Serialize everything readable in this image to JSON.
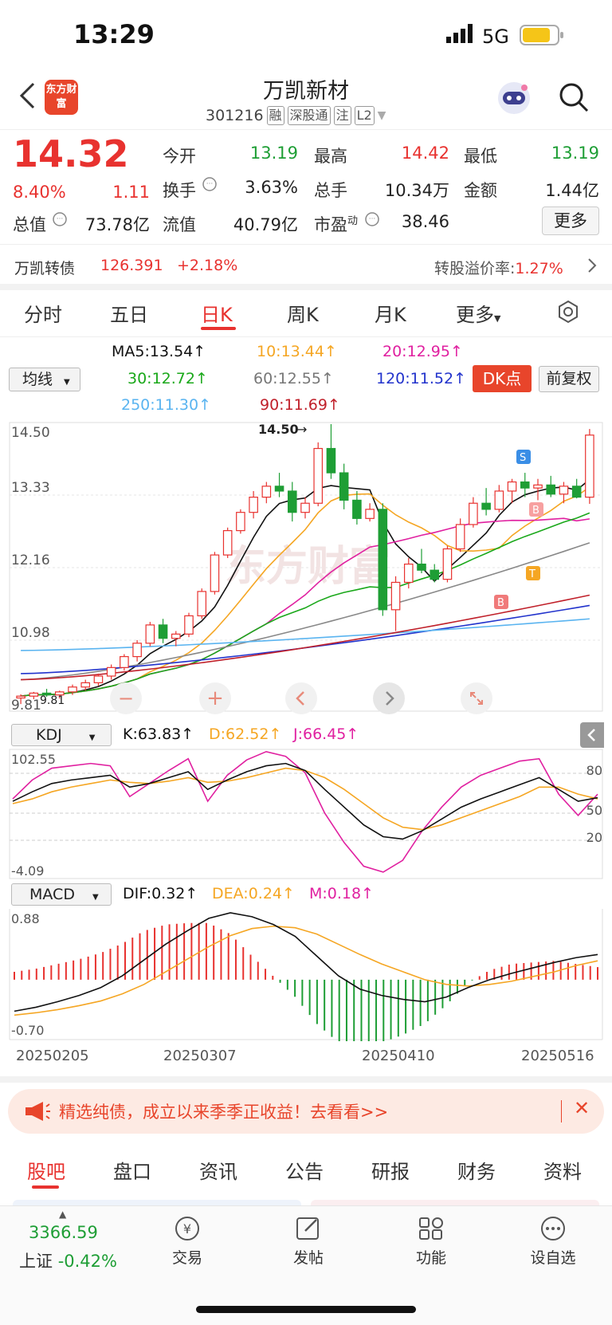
{
  "status": {
    "time": "13:29",
    "network": "5G"
  },
  "header": {
    "logo_text": "东方财富",
    "title": "万凯新材",
    "code": "301216",
    "tags": [
      "融",
      "深股通",
      "注",
      "L2"
    ]
  },
  "quote": {
    "price": "14.32",
    "change_pct": "8.40%",
    "change": "1.11",
    "open_label": "今开",
    "open": "13.19",
    "high_label": "最高",
    "high": "14.42",
    "low_label": "最低",
    "low": "13.19",
    "turnover_label": "换手",
    "turnover": "3.63%",
    "volume_label": "总手",
    "volume": "10.34万",
    "amount_label": "金额",
    "amount": "1.44亿",
    "mktcap_label": "总值",
    "mktcap": "73.78亿",
    "float_label": "流值",
    "float": "40.79亿",
    "pe_label": "市盈",
    "pe_sup": "动",
    "pe": "38.46",
    "more_label": "更多"
  },
  "bond": {
    "name": "万凯转债",
    "price": "126.391",
    "change": "+2.18%",
    "premium_label": "转股溢价率:",
    "premium": "1.27%"
  },
  "period_tabs": [
    "分时",
    "五日",
    "日K",
    "周K",
    "月K",
    "更多"
  ],
  "active_period": "日K",
  "ma": {
    "selector": "均线",
    "ma5": "MA5:13.54",
    "ma10": "10:13.44",
    "ma20": "20:12.95",
    "ma30": "30:12.72",
    "ma60": "60:12.55",
    "ma120": "120:11.52",
    "ma250": "250:11.30",
    "ma90": "90:11.69",
    "dk_label": "DK点",
    "adjust_label": "前复权"
  },
  "colors": {
    "red": "#e8322f",
    "green": "#1e9e35",
    "ma5": "#111111",
    "ma10": "#f5a623",
    "ma20": "#e020a0",
    "ma30": "#1aa81a",
    "ma60": "#888888",
    "ma120": "#2233cc",
    "ma250": "#5ab4f0",
    "ma90": "#c0202a"
  },
  "price_axis": {
    "top": "14.50",
    "l2": "13.33",
    "l3": "12.16",
    "l4": "10.98",
    "bottom": "9.81"
  },
  "annotations": {
    "high_mark": "14.50",
    "low_mark": "9.81"
  },
  "kdj": {
    "selector": "KDJ",
    "k": "K:63.83",
    "d": "D:62.52",
    "j": "J:66.45",
    "top": "102.55",
    "bottom": "-4.09",
    "lvl80": "80",
    "lvl50": "50",
    "lvl20": "20"
  },
  "macd": {
    "selector": "MACD",
    "dif": "DIF:0.32",
    "dea": "DEA:0.24",
    "m": "M:0.18",
    "top": "0.88",
    "bottom": "-0.70"
  },
  "dates": [
    "20250205",
    "20250307",
    "20250410",
    "20250516"
  ],
  "banner": {
    "text": "精选纯债，成立以来季季正收益！去看看>>"
  },
  "content_tabs": [
    "股吧",
    "盘口",
    "资讯",
    "公告",
    "研报",
    "财务",
    "资料"
  ],
  "bottom_nav": {
    "index_value": "3366.59",
    "index_name": "上证",
    "index_change": "-0.42%",
    "items": [
      "交易",
      "发帖",
      "功能",
      "设自选"
    ]
  },
  "chart_data": {
    "type": "candlestick",
    "ohlc_approx": [
      [
        10.0,
        10.06,
        9.9,
        10.03
      ],
      [
        10.03,
        10.1,
        9.98,
        10.08
      ],
      [
        10.08,
        10.15,
        10.02,
        10.05
      ],
      [
        10.05,
        10.12,
        9.99,
        10.1
      ],
      [
        10.1,
        10.22,
        10.05,
        10.18
      ],
      [
        10.18,
        10.3,
        10.12,
        10.25
      ],
      [
        10.25,
        10.4,
        10.2,
        10.36
      ],
      [
        10.36,
        10.55,
        10.3,
        10.5
      ],
      [
        10.5,
        10.72,
        10.45,
        10.68
      ],
      [
        10.68,
        10.95,
        10.6,
        10.9
      ],
      [
        10.9,
        11.25,
        10.85,
        11.2
      ],
      [
        11.2,
        11.3,
        10.9,
        10.98
      ],
      [
        10.98,
        11.1,
        10.85,
        11.05
      ],
      [
        11.05,
        11.4,
        11.0,
        11.35
      ],
      [
        11.35,
        11.8,
        11.3,
        11.75
      ],
      [
        11.75,
        12.4,
        11.7,
        12.35
      ],
      [
        12.35,
        12.8,
        12.3,
        12.75
      ],
      [
        12.75,
        13.1,
        12.7,
        13.05
      ],
      [
        13.05,
        13.4,
        12.95,
        13.3
      ],
      [
        13.3,
        13.55,
        13.2,
        13.48
      ],
      [
        13.48,
        13.7,
        13.3,
        13.4
      ],
      [
        13.4,
        13.55,
        12.9,
        13.05
      ],
      [
        13.05,
        13.3,
        12.95,
        13.2
      ],
      [
        13.2,
        14.2,
        13.15,
        14.1
      ],
      [
        14.1,
        14.5,
        13.6,
        13.7
      ],
      [
        13.7,
        13.85,
        13.1,
        13.25
      ],
      [
        13.25,
        13.4,
        12.85,
        12.95
      ],
      [
        12.95,
        13.2,
        12.9,
        13.1
      ],
      [
        13.1,
        13.2,
        11.35,
        11.45
      ],
      [
        11.45,
        12.0,
        11.1,
        11.9
      ],
      [
        11.9,
        12.3,
        11.8,
        12.2
      ],
      [
        12.2,
        12.45,
        12.05,
        12.1
      ],
      [
        12.1,
        12.2,
        11.9,
        11.95
      ],
      [
        11.95,
        12.5,
        11.9,
        12.45
      ],
      [
        12.45,
        12.95,
        12.4,
        12.85
      ],
      [
        12.85,
        13.3,
        12.8,
        13.2
      ],
      [
        13.2,
        13.45,
        13.0,
        13.1
      ],
      [
        13.1,
        13.5,
        13.05,
        13.4
      ],
      [
        13.4,
        13.6,
        13.2,
        13.55
      ],
      [
        13.55,
        13.7,
        13.3,
        13.45
      ],
      [
        13.45,
        13.6,
        13.25,
        13.5
      ],
      [
        13.5,
        13.65,
        13.3,
        13.35
      ],
      [
        13.35,
        13.55,
        13.2,
        13.48
      ],
      [
        13.48,
        13.6,
        13.28,
        13.3
      ],
      [
        13.3,
        14.42,
        13.19,
        14.32
      ]
    ],
    "kdj_k": [
      60,
      68,
      75,
      78,
      80,
      82,
      72,
      75,
      80,
      85,
      70,
      78,
      85,
      90,
      92,
      86,
      70,
      55,
      40,
      30,
      28,
      35,
      45,
      55,
      62,
      68,
      74,
      80,
      70,
      60,
      63
    ],
    "kdj_d": [
      58,
      62,
      68,
      72,
      75,
      78,
      76,
      75,
      77,
      80,
      76,
      77,
      80,
      84,
      88,
      86,
      80,
      70,
      58,
      46,
      38,
      36,
      40,
      46,
      52,
      58,
      64,
      72,
      72,
      66,
      62
    ],
    "kdj_j": [
      62,
      78,
      88,
      90,
      92,
      90,
      64,
      75,
      86,
      96,
      60,
      82,
      95,
      102,
      98,
      84,
      50,
      25,
      5,
      0,
      10,
      35,
      55,
      72,
      82,
      88,
      94,
      96,
      66,
      48,
      66
    ],
    "macd_dif": [
      -0.4,
      -0.35,
      -0.28,
      -0.2,
      -0.1,
      0.05,
      0.25,
      0.45,
      0.62,
      0.78,
      0.85,
      0.8,
      0.7,
      0.55,
      0.3,
      0.05,
      -0.12,
      -0.2,
      -0.25,
      -0.28,
      -0.22,
      -0.1,
      0.0,
      0.08,
      0.15,
      0.22,
      0.28,
      0.32
    ],
    "macd_dea": [
      -0.45,
      -0.42,
      -0.38,
      -0.33,
      -0.27,
      -0.18,
      -0.06,
      0.1,
      0.26,
      0.42,
      0.56,
      0.65,
      0.68,
      0.66,
      0.58,
      0.45,
      0.32,
      0.2,
      0.1,
      0.0,
      -0.06,
      -0.08,
      -0.06,
      -0.02,
      0.04,
      0.1,
      0.18,
      0.24
    ]
  }
}
